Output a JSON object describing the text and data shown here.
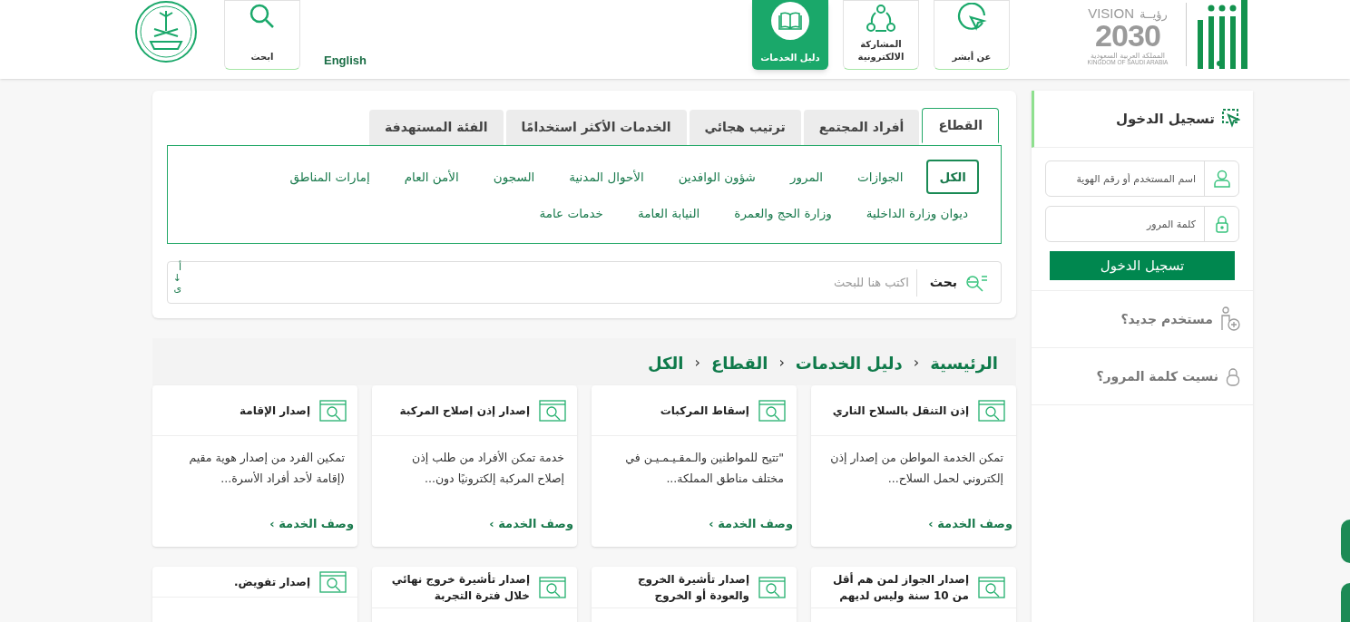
{
  "header": {
    "vision_logo": {
      "vision": "VISION",
      "ruya": "رؤيــة",
      "year": "2030",
      "country_ar": "المملكة العربية السعودية",
      "country_en": "KINGDOM OF SAUDI ARABIA"
    },
    "nav": [
      {
        "kind": "about",
        "label": "عن أبشر",
        "selected": false
      },
      {
        "kind": "participation",
        "label": "المشاركة الالكترونية",
        "selected": false
      },
      {
        "kind": "guide",
        "label": "دليل الخدمات",
        "selected": true
      }
    ],
    "language_link": "English",
    "search_button": "ابحث"
  },
  "login": {
    "title": "تسجيل الدخول",
    "username_placeholder": "اسم المستخدم أو رقم الهوية",
    "password_placeholder": "كلمة المرور",
    "submit": "تسجيل الدخول",
    "new_user": "مستخدم جديد؟",
    "forgot_password": "نسيت كلمة المرور؟"
  },
  "tabs": [
    {
      "label": "القطاع",
      "selected": true
    },
    {
      "label": "أفراد المجتمع",
      "selected": false
    },
    {
      "label": "ترتيب هجائي",
      "selected": false
    },
    {
      "label": "الخدمات الأكثر استخدامًا",
      "selected": false
    },
    {
      "label": "الفئة المستهدفة",
      "selected": false
    }
  ],
  "sectors": [
    {
      "label": "الكل",
      "selected": true
    },
    {
      "label": "الجوازات",
      "selected": false
    },
    {
      "label": "المرور",
      "selected": false
    },
    {
      "label": "شؤون الوافدين",
      "selected": false
    },
    {
      "label": "الأحوال المدنية",
      "selected": false
    },
    {
      "label": "السجون",
      "selected": false
    },
    {
      "label": "الأمن العام",
      "selected": false
    },
    {
      "label": "إمارات المناطق",
      "selected": false
    },
    {
      "label": "ديوان وزارة الداخلية",
      "selected": false
    },
    {
      "label": "وزارة الحج والعمرة",
      "selected": false
    },
    {
      "label": "النيابة العامة",
      "selected": false
    },
    {
      "label": "خدمات عامة",
      "selected": false
    }
  ],
  "search": {
    "button": "بحث",
    "placeholder": "اكتب هنا للبحث",
    "sort_label": "أ↓ى"
  },
  "breadcrumb": [
    {
      "kind": "link",
      "label": "الرئيسية"
    },
    {
      "kind": "separator",
      "label": "›"
    },
    {
      "kind": "link",
      "label": "دليل الخدمات"
    },
    {
      "kind": "separator",
      "label": "›"
    },
    {
      "kind": "link",
      "label": "القطاع"
    },
    {
      "kind": "separator",
      "label": "›"
    },
    {
      "kind": "link",
      "label": "الكل"
    }
  ],
  "cards": [
    {
      "title": "إذن التنقل بالسلاح الناري",
      "description": "تمكن الخدمة المواطن من إصدار إذن إلكتروني لحمل السلاح...",
      "link": "وصف الخدمة ›"
    },
    {
      "title": "إسقاط المركبات",
      "description": "\"تتيح للمواطنين والـمقـيـمـيـن في مختلف مناطق المملكة...",
      "link": "وصف الخدمة ›"
    },
    {
      "title": "إصدار إذن إصلاح المركبة",
      "description": "خدمة تمكن الأفراد من طلب إذن إصلاح المركبة إلكترونيًا دون...",
      "link": "وصف الخدمة ›"
    },
    {
      "title": "إصدار الإقامة",
      "description": "تمكين الفرد من إصدار هوية مقيم (إقامة لأحد أفراد الأسرة...",
      "link": "وصف الخدمة ›"
    },
    {
      "title": "إصدار الجواز لمن هم أقل من 10 سنة وليس لديهم"
    },
    {
      "title": "إصدار تأشيرة الخروج والعودة أو الخروج"
    },
    {
      "title": "إصدار تأشيرة خروج نهائي خلال فترة التجربة"
    },
    {
      "title": "إصدار تفويض."
    }
  ]
}
